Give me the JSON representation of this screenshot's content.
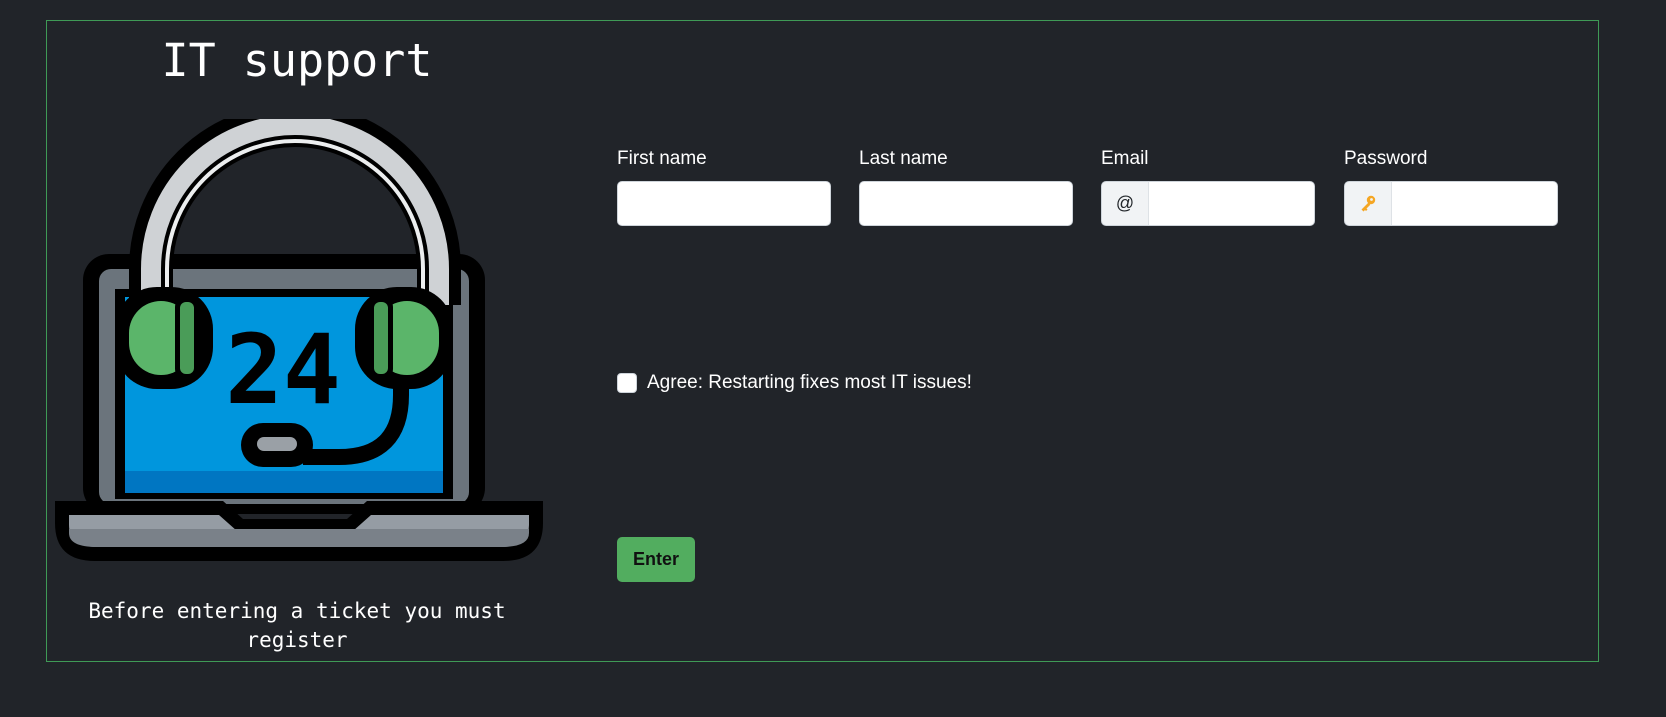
{
  "header": {
    "title": "IT support"
  },
  "hero": {
    "icon": "headset-laptop-24-icon",
    "badge_text": "24"
  },
  "caption": "Before entering a ticket you must register",
  "form": {
    "first_name": {
      "label": "First name",
      "value": ""
    },
    "last_name": {
      "label": "Last name",
      "value": ""
    },
    "email": {
      "label": "Email",
      "addon": "@",
      "value": ""
    },
    "password": {
      "label": "Password",
      "addon_icon": "key-icon",
      "value": ""
    },
    "agree": {
      "label": "Agree: Restarting fixes most IT issues!",
      "checked": false
    },
    "submit_label": "Enter"
  },
  "colors": {
    "background": "#212429",
    "frame_border": "#3f9a56",
    "accent_green": "#52ad5f",
    "screen_blue": "#0096dd",
    "key_yellow": "#f5a623"
  }
}
